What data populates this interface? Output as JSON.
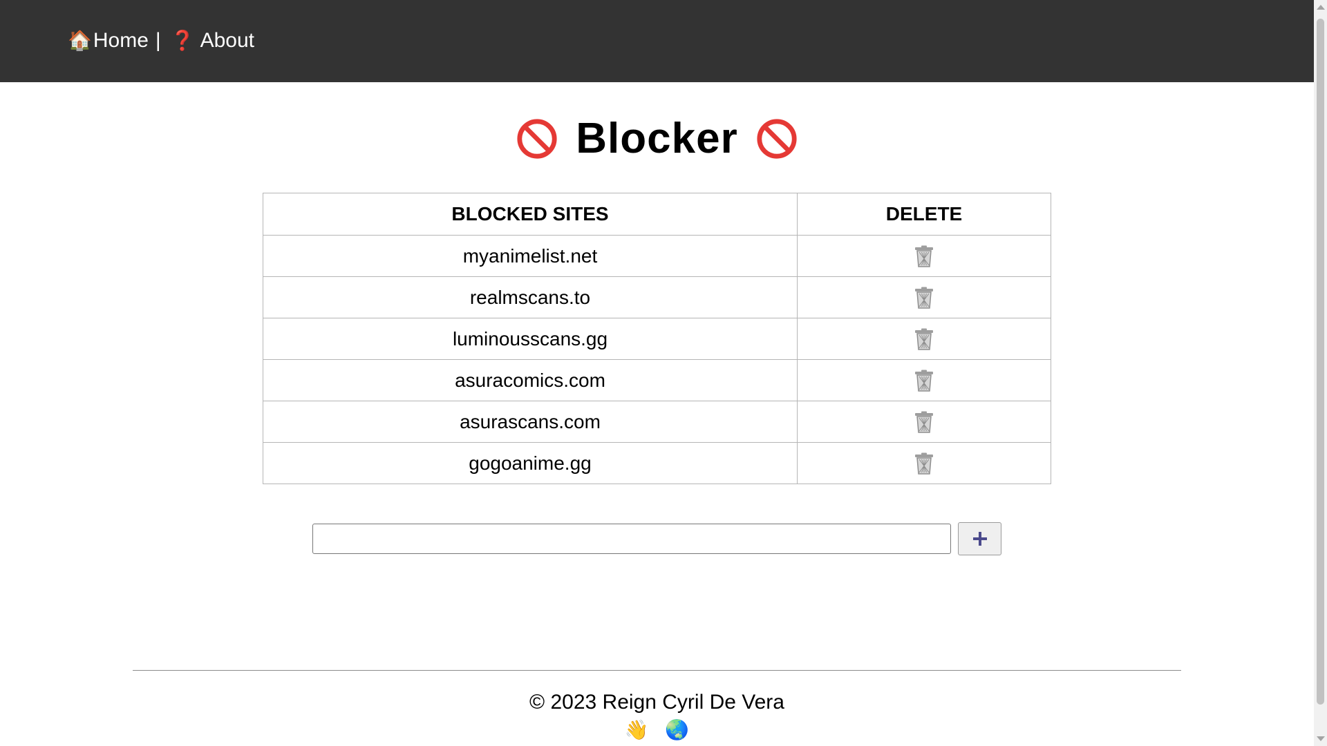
{
  "nav": {
    "home_icon": "🏠",
    "home_label": "Home",
    "separator": "|",
    "about_icon": "❓",
    "about_label": "About"
  },
  "title": {
    "text": "Blocker",
    "icon": "no-entry-icon"
  },
  "table": {
    "headers": {
      "site": "BLOCKED SITES",
      "delete": "DELETE"
    },
    "rows": [
      {
        "site": "myanimelist.net",
        "delete_icon": "trash-icon"
      },
      {
        "site": "realmscans.to",
        "delete_icon": "trash-icon"
      },
      {
        "site": "luminousscans.gg",
        "delete_icon": "trash-icon"
      },
      {
        "site": "asuracomics.com",
        "delete_icon": "trash-icon"
      },
      {
        "site": "asurascans.com",
        "delete_icon": "trash-icon"
      },
      {
        "site": "gogoanime.gg",
        "delete_icon": "trash-icon"
      }
    ]
  },
  "add_form": {
    "input_value": "",
    "button_icon": "plus-icon"
  },
  "footer": {
    "copyright": "© 2023 Reign Cyril De Vera",
    "wave_icon": "👋",
    "globe_icon": "🌏"
  },
  "colors": {
    "nav_bg": "#333333",
    "no_entry_red": "#e53935",
    "plus_purple": "#4b4a8c"
  }
}
